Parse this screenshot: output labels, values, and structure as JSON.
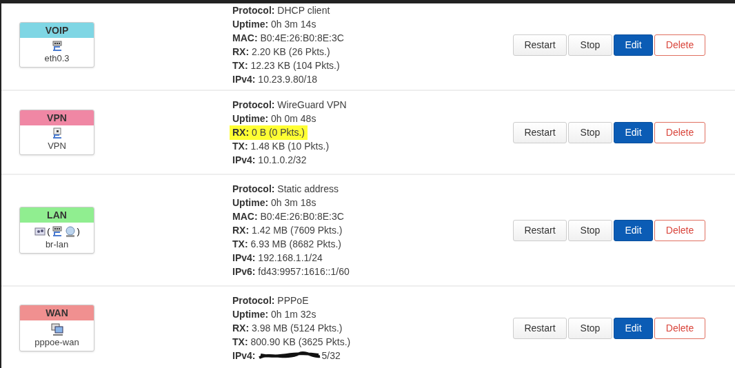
{
  "interfaces": [
    {
      "name": "VOIP",
      "color": "#7fd6e4",
      "kind": "ethernet",
      "device": "eth0.3",
      "details": [
        {
          "label": "Protocol:",
          "value": "DHCP client",
          "highlighted": false
        },
        {
          "label": "Uptime:",
          "value": "0h 3m 14s",
          "highlighted": false
        },
        {
          "label": "MAC:",
          "value": "B0:4E:26:B0:8E:3C",
          "highlighted": false
        },
        {
          "label": "RX:",
          "value": "2.20 KB (26 Pkts.)",
          "highlighted": false
        },
        {
          "label": "TX:",
          "value": "12.23 KB (104 Pkts.)",
          "highlighted": false
        },
        {
          "label": "IPv4:",
          "value": "10.23.9.80/18",
          "highlighted": false
        }
      ],
      "buttons": [
        "Restart",
        "Stop",
        "Edit",
        "Delete"
      ]
    },
    {
      "name": "VPN",
      "color": "#f087a4",
      "kind": "tunnel",
      "device": "VPN",
      "details": [
        {
          "label": "Protocol:",
          "value": "WireGuard VPN",
          "highlighted": false
        },
        {
          "label": "Uptime:",
          "value": "0h 0m 48s",
          "highlighted": false
        },
        {
          "label": "RX:",
          "value": "0 B (0 Pkts.)",
          "highlighted": true
        },
        {
          "label": "TX:",
          "value": "1.48 KB (10 Pkts.)",
          "highlighted": false
        },
        {
          "label": "IPv4:",
          "value": "10.1.0.2/32",
          "highlighted": false
        }
      ],
      "buttons": [
        "Restart",
        "Stop",
        "Edit",
        "Delete"
      ]
    },
    {
      "name": "LAN",
      "color": "#90ee90",
      "kind": "bridge",
      "brackets": [
        "(",
        ")"
      ],
      "device": "br-lan",
      "details": [
        {
          "label": "Protocol:",
          "value": "Static address",
          "highlighted": false
        },
        {
          "label": "Uptime:",
          "value": "0h 3m 18s",
          "highlighted": false
        },
        {
          "label": "MAC:",
          "value": "B0:4E:26:B0:8E:3C",
          "highlighted": false
        },
        {
          "label": "RX:",
          "value": "1.42 MB (7609 Pkts.)",
          "highlighted": false
        },
        {
          "label": "TX:",
          "value": "6.93 MB (8682 Pkts.)",
          "highlighted": false
        },
        {
          "label": "IPv4:",
          "value": "192.168.1.1/24",
          "highlighted": false
        },
        {
          "label": "IPv6:",
          "value": "fd43:9957:1616::1/60",
          "highlighted": false
        }
      ],
      "buttons": [
        "Restart",
        "Stop",
        "Edit",
        "Delete"
      ]
    },
    {
      "name": "WAN",
      "color": "#f09090",
      "kind": "wan",
      "device": "pppoe-wan",
      "details": [
        {
          "label": "Protocol:",
          "value": "PPPoE",
          "highlighted": false
        },
        {
          "label": "Uptime:",
          "value": "0h 1m 32s",
          "highlighted": false
        },
        {
          "label": "RX:",
          "value": "3.98 MB (5124 Pkts.)",
          "highlighted": false
        },
        {
          "label": "TX:",
          "value": "800.90 KB (3625 Pkts.)",
          "highlighted": false
        },
        {
          "label": "IPv4:",
          "value": "5/32",
          "highlighted": false,
          "redacted": true
        }
      ],
      "buttons": [
        "Restart",
        "Stop",
        "Edit",
        "Delete"
      ]
    }
  ]
}
